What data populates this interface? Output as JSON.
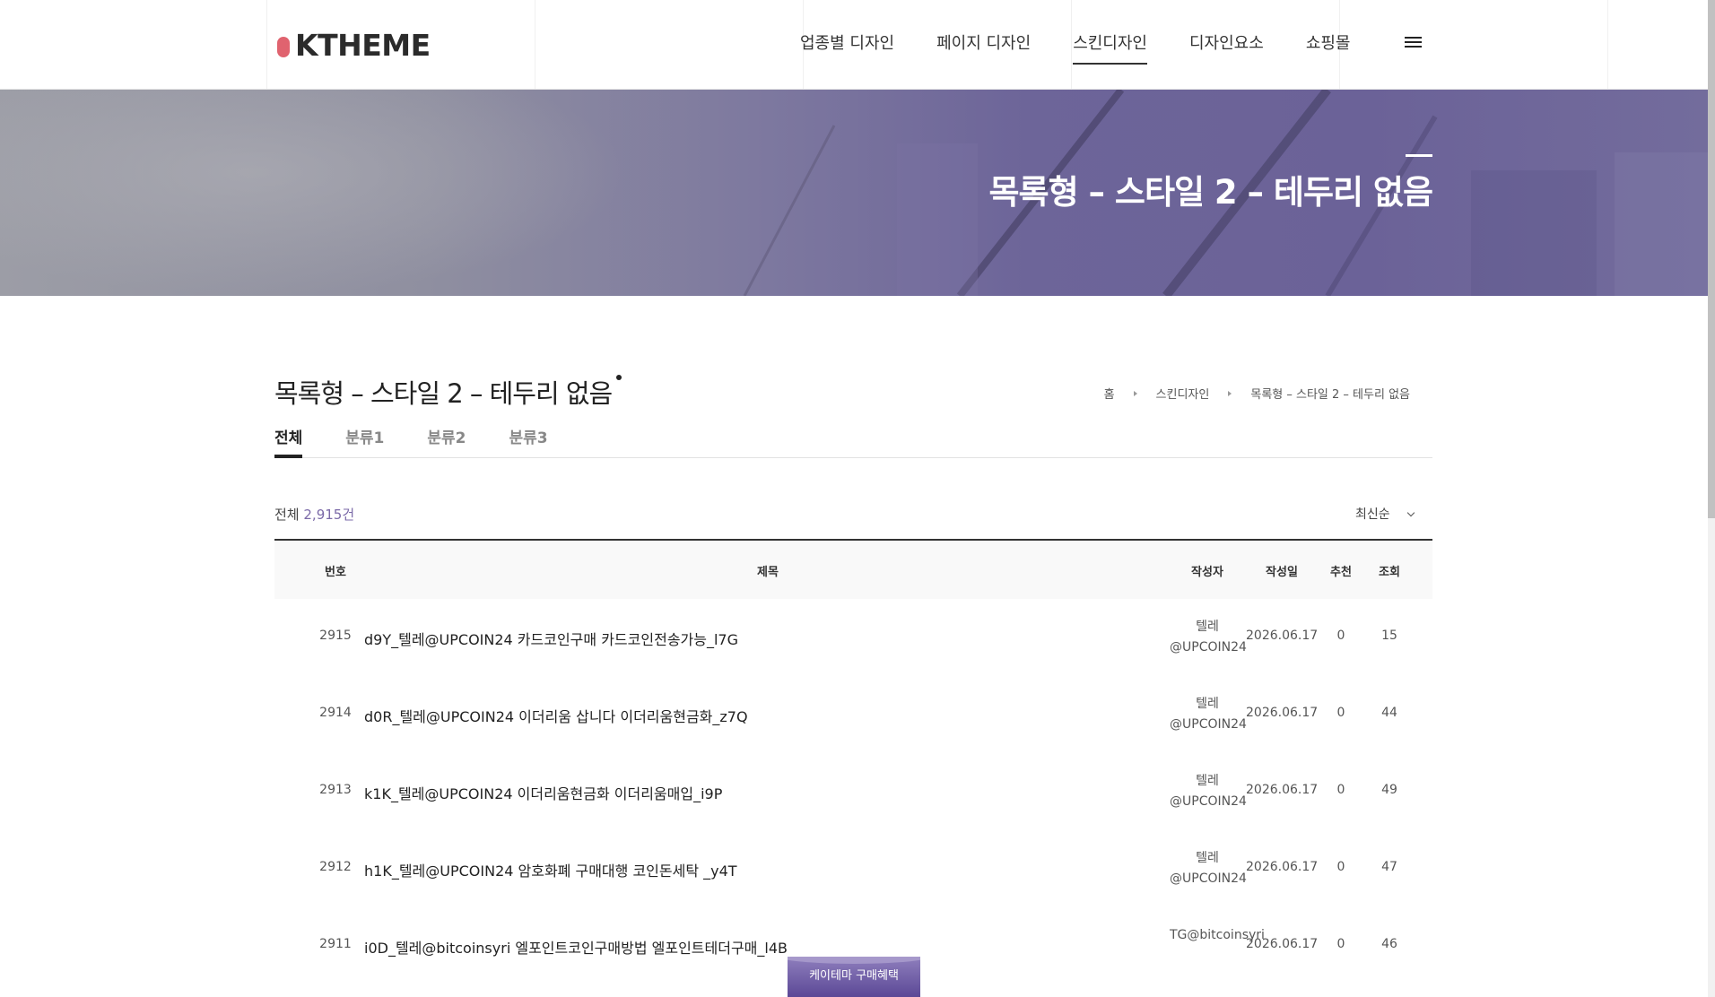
{
  "header": {
    "logo_text": "KTHEME",
    "nav": [
      "업종별 디자인",
      "페이지 디자인",
      "스킨디자인",
      "디자인요소",
      "쇼핑몰"
    ],
    "active_nav": 2
  },
  "hero": {
    "title": "목록형 – 스타일 2 – 테두리 없음"
  },
  "page": {
    "title": "목록형 – 스타일 2 – 테두리 없음",
    "breadcrumb": [
      "홈",
      "스킨디자인",
      "목록형 – 스타일 2 – 테두리 없음"
    ]
  },
  "tabs": [
    "전체",
    "분류1",
    "분류2",
    "분류3"
  ],
  "total": {
    "label": "전체",
    "count": "2,915건"
  },
  "sort": {
    "selected": "최신순"
  },
  "table": {
    "headers": [
      "번호",
      "제목",
      "작성자",
      "작성일",
      "추천",
      "조회"
    ],
    "rows": [
      {
        "no": "2915",
        "title": "d9Y_텔레@UPCOIN24 카드코인구매 카드코인전송가능_l7G",
        "author": "텔레@UPCOIN24",
        "date": "2026.06.17",
        "likes": "0",
        "views": "15"
      },
      {
        "no": "2914",
        "title": "d0R_텔레@UPCOIN24 이더리움 삽니다 이더리움현금화_z7Q",
        "author": "텔레@UPCOIN24",
        "date": "2026.06.17",
        "likes": "0",
        "views": "44"
      },
      {
        "no": "2913",
        "title": "k1K_텔레@UPCOIN24 이더리움현금화 이더리움매입_i9P",
        "author": "텔레@UPCOIN24",
        "date": "2026.06.17",
        "likes": "0",
        "views": "49"
      },
      {
        "no": "2912",
        "title": "h1K_텔레@UPCOIN24 암호화폐 구매대행 코인돈세탁 _y4T",
        "author": "텔레@UPCOIN24",
        "date": "2026.06.17",
        "likes": "0",
        "views": "47"
      },
      {
        "no": "2911",
        "title": "i0D_텔레@bitcoinsyri 엘포인트코인구매방법 엘포인트테더구매_l4B",
        "author": "TG@bitcoinsyri",
        "date": "2026.06.17",
        "likes": "0",
        "views": "46"
      }
    ]
  },
  "float_button": {
    "label": "케이테마 구매혜택"
  },
  "colors": {
    "accent": "#7b6aa8",
    "logo_dot": "#e0636f",
    "hero": "#6d6599"
  }
}
